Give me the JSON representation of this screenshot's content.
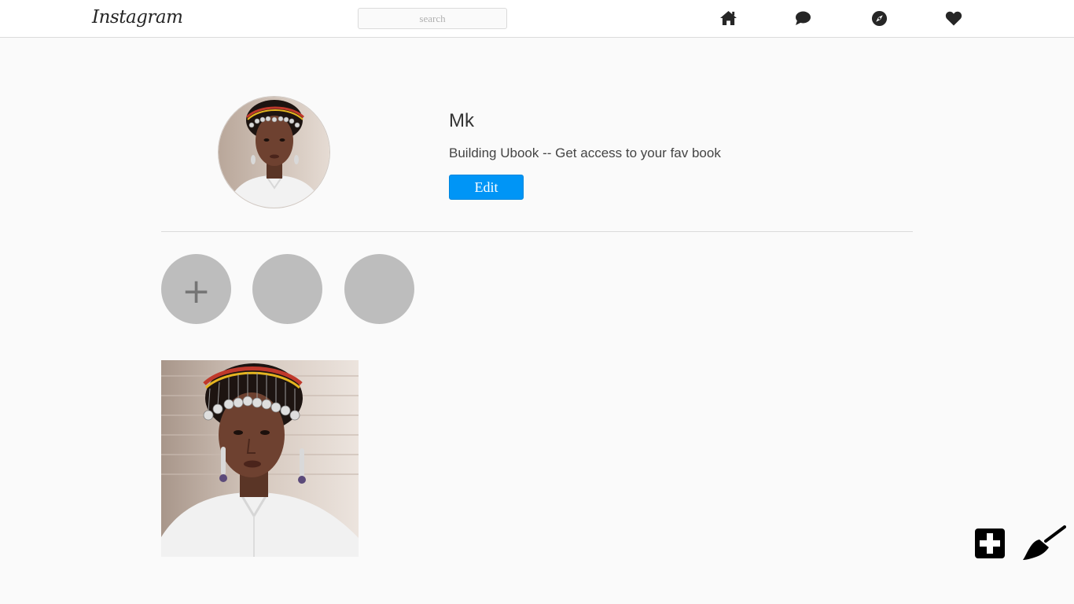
{
  "app": {
    "logo_text": "Instagram"
  },
  "search": {
    "placeholder": "search"
  },
  "nav": {
    "icons": [
      "home-icon",
      "chat-bubble-icon",
      "compass-icon",
      "heart-icon"
    ]
  },
  "profile": {
    "username": "Mk",
    "bio": "Building Ubook -- Get access to your fav book",
    "edit_label": "Edit"
  },
  "highlights": {
    "add_symbol": "+",
    "count": 3
  },
  "posts": [
    {
      "kind": "portrait-photo"
    }
  ],
  "floating_actions": [
    "add-post-icon",
    "paint-brush-icon"
  ],
  "colors": {
    "accent": "#0095f6",
    "background": "#fafafa",
    "highlight_fill": "#bdbdbd"
  }
}
